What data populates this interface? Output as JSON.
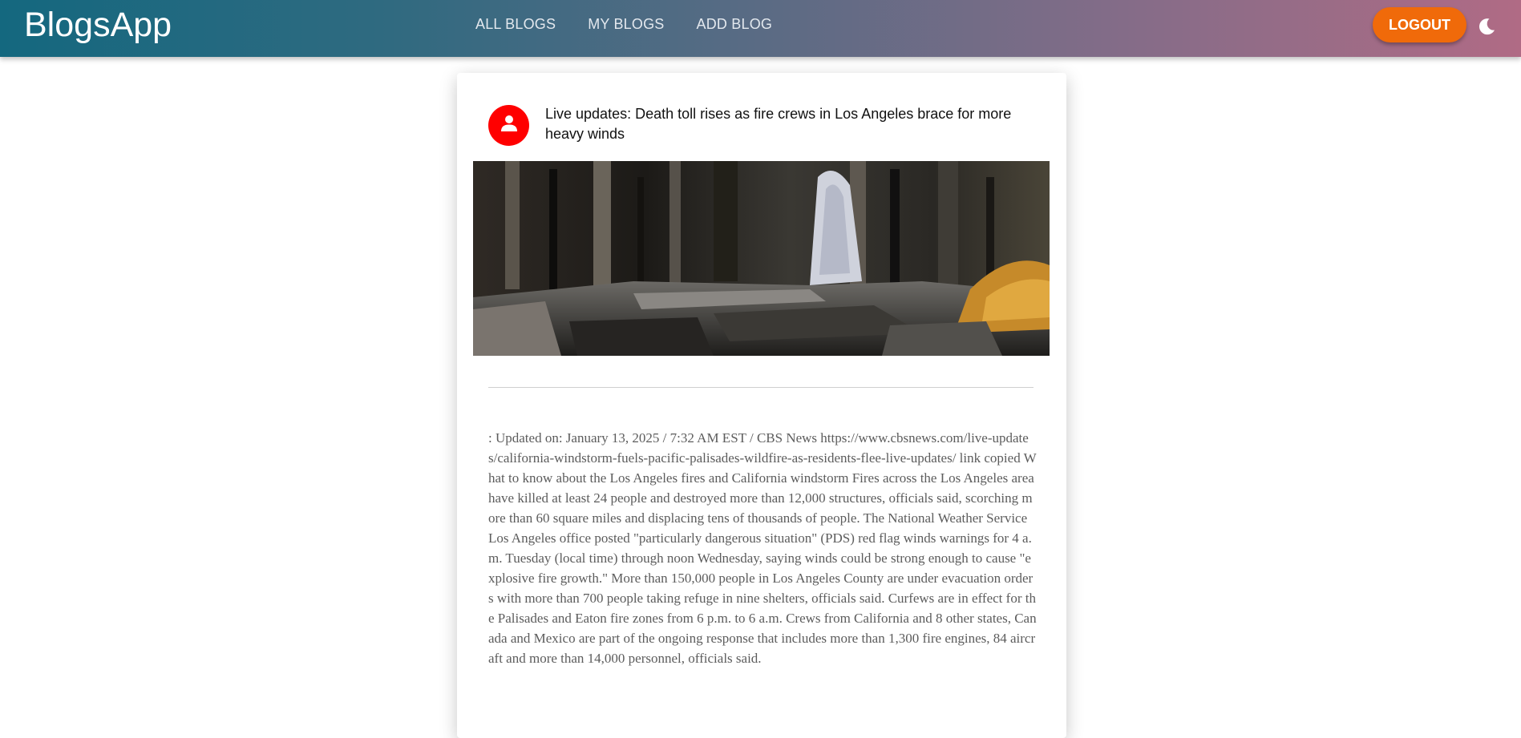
{
  "app": {
    "title": "BlogsApp"
  },
  "nav": {
    "items": [
      {
        "label": "ALL BLOGS"
      },
      {
        "label": "MY BLOGS"
      },
      {
        "label": "ADD BLOG"
      }
    ]
  },
  "header": {
    "logout_label": "LOGOUT",
    "theme_icon": "moon-icon",
    "accent_color": "#f06a0a"
  },
  "post": {
    "avatar_icon": "person-icon",
    "avatar_color": "#ff0000",
    "title": "Live updates: Death toll rises as fire crews in Los Angeles brace for more heavy winds",
    "image_icon": "fire-aftermath-photo",
    "body": ": Updated on: January 13, 2025 / 7:32 AM EST / CBS News https://www.cbsnews.com/live-updates/california-windstorm-fuels-pacific-palisades-wildfire-as-residents-flee-live-updates/ link copied What to know about the Los Angeles fires and California windstorm Fires across the Los Angeles area have killed at least 24 people and destroyed more than 12,000 structures, officials said, scorching more than 60 square miles and displacing tens of thousands of people. The National Weather Service Los Angeles office posted \"particularly dangerous situation\" (PDS) red flag winds warnings for 4 a.m. Tuesday (local time) through noon Wednesday, saying winds could be strong enough to cause \"explosive fire growth.\" More than 150,000 people in Los Angeles County are under evacuation orders with more than 700 people taking refuge in nine shelters, officials said. Curfews are in effect for the Palisades and Eaton fire zones from 6 p.m. to 6 a.m. Crews from California and 8 other states, Canada and Mexico are part of the ongoing response that includes more than 1,300 fire engines, 84 aircraft and more than 14,000 personnel, officials said."
  }
}
